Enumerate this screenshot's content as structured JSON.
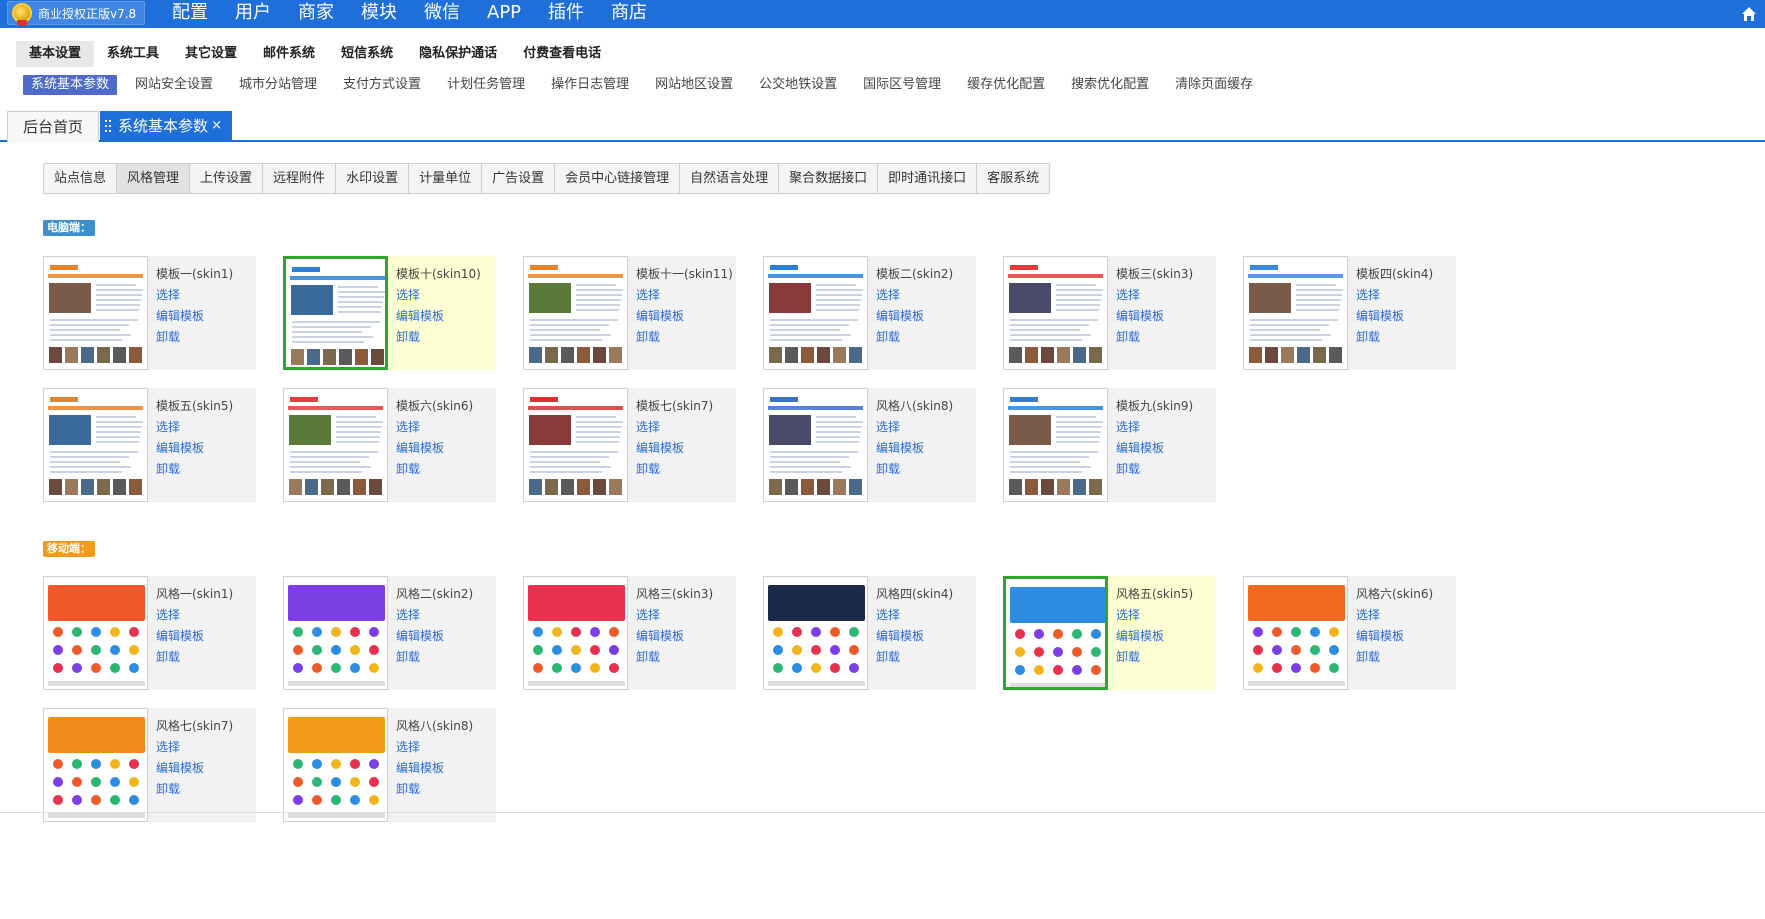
{
  "app": {
    "license_label": "商业授权正版v7.8"
  },
  "topnav": [
    "配置",
    "用户",
    "商家",
    "模块",
    "微信",
    "APP",
    "插件",
    "商店"
  ],
  "menu2": {
    "items": [
      "基本设置",
      "系统工具",
      "其它设置",
      "邮件系统",
      "短信系统",
      "隐私保护通话",
      "付费查看电话"
    ],
    "active_index": 0
  },
  "menu3": {
    "items": [
      "系统基本参数",
      "网站安全设置",
      "城市分站管理",
      "支付方式设置",
      "计划任务管理",
      "操作日志管理",
      "网站地区设置",
      "公交地铁设置",
      "国际区号管理",
      "缓存优化配置",
      "搜索优化配置",
      "清除页面缓存"
    ],
    "active_index": 0
  },
  "tabs": {
    "home": "后台首页",
    "current": "系统基本参数",
    "close": "×"
  },
  "subtabs": {
    "items": [
      "站点信息",
      "风格管理",
      "上传设置",
      "远程附件",
      "水印设置",
      "计量单位",
      "广告设置",
      "会员中心链接管理",
      "自然语言处理",
      "聚合数据接口",
      "即时通讯接口",
      "客服系统"
    ],
    "active_index": 1
  },
  "sections": {
    "pc_label": "电脑端：",
    "mobile_label": "移动端："
  },
  "actions": {
    "select": "选择",
    "edit": "编辑模板",
    "uninstall": "卸载"
  },
  "pc_templates": [
    {
      "name": "模板一(skin1)",
      "selected": false,
      "accent": "#e8842a"
    },
    {
      "name": "模板十(skin10)",
      "selected": true,
      "accent": "#2e7fd6"
    },
    {
      "name": "模板十一(skin11)",
      "selected": false,
      "accent": "#e8842a"
    },
    {
      "name": "模板二(skin2)",
      "selected": false,
      "accent": "#2e7fd6"
    },
    {
      "name": "模板三(skin3)",
      "selected": false,
      "accent": "#e33c3c"
    },
    {
      "name": "模板四(skin4)",
      "selected": false,
      "accent": "#3a8ad8"
    },
    {
      "name": "模板五(skin5)",
      "selected": false,
      "accent": "#e8842a"
    },
    {
      "name": "模板六(skin6)",
      "selected": false,
      "accent": "#e33c3c"
    },
    {
      "name": "模板七(skin7)",
      "selected": false,
      "accent": "#d93030"
    },
    {
      "name": "风格八(skin8)",
      "selected": false,
      "accent": "#3a6fd0"
    },
    {
      "name": "模板九(skin9)",
      "selected": false,
      "accent": "#2e7fd6"
    }
  ],
  "mobile_templates": [
    {
      "name": "风格一(skin1)",
      "selected": false,
      "accent": "#f05a2a"
    },
    {
      "name": "风格二(skin2)",
      "selected": false,
      "accent": "#7b3fe4"
    },
    {
      "name": "风格三(skin3)",
      "selected": false,
      "accent": "#e8304f"
    },
    {
      "name": "风格四(skin4)",
      "selected": false,
      "accent": "#1c2a4a"
    },
    {
      "name": "风格五(skin5)",
      "selected": true,
      "accent": "#2d8de0"
    },
    {
      "name": "风格六(skin6)",
      "selected": false,
      "accent": "#f06a20"
    },
    {
      "name": "风格七(skin7)",
      "selected": false,
      "accent": "#f28a1c"
    },
    {
      "name": "风格八(skin8)",
      "selected": false,
      "accent": "#f29a1c"
    }
  ],
  "colors": {
    "primary": "#1e6fd9",
    "selected_border": "#2ea52e",
    "selected_bg": "#ffffd4",
    "link": "#2a6ad9"
  }
}
